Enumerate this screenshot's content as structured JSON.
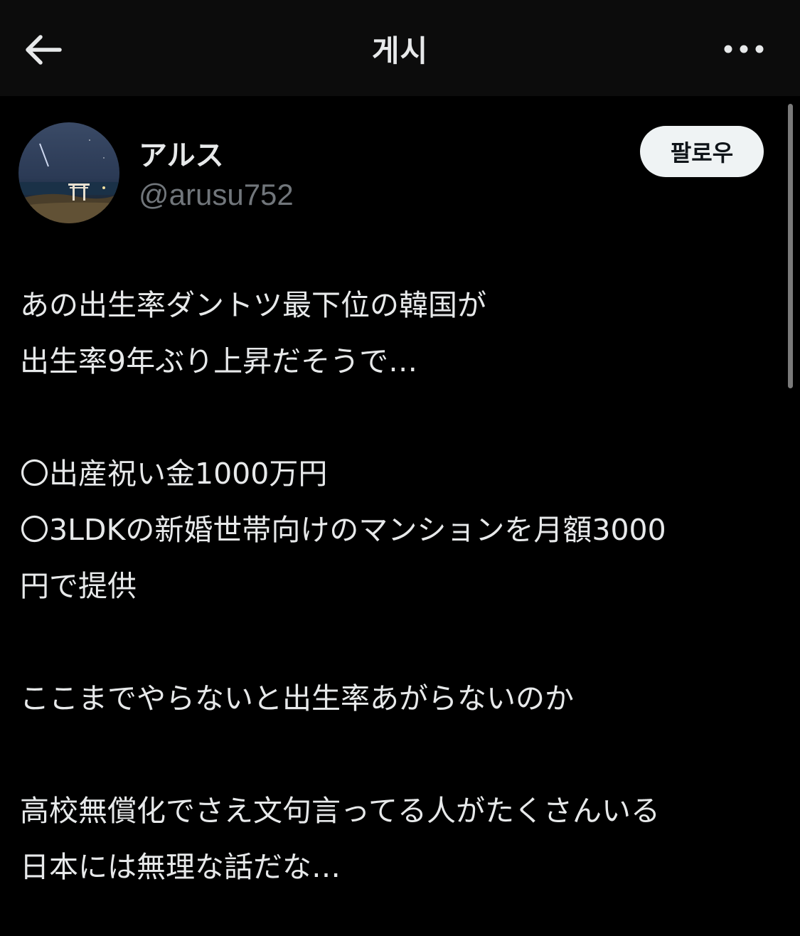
{
  "header": {
    "title": "게시",
    "back_icon": "arrow-left-icon",
    "more_icon": "more-horizontal-icon"
  },
  "author": {
    "display_name": "アルス",
    "handle": "@arusu752",
    "follow_label": "팔로우"
  },
  "post": {
    "lines": [
      "あの出生率ダントツ最下位の韓国が",
      "出生率9年ぶり上昇だそうで…",
      "",
      "〇出産祝い金1000万円",
      "〇3LDKの新婚世帯向けのマンションを月額3000",
      "円で提供",
      "",
      "ここまでやらないと出生率あがらないのか",
      "",
      "高校無償化でさえ文句言ってる人がたくさんいる",
      "日本には無理な話だな…"
    ]
  },
  "colors": {
    "background": "#000000",
    "topbar": "#0c0c0c",
    "text": "#e7e9ea",
    "secondary_text": "#71767b",
    "follow_button_bg": "#eff3f4"
  }
}
